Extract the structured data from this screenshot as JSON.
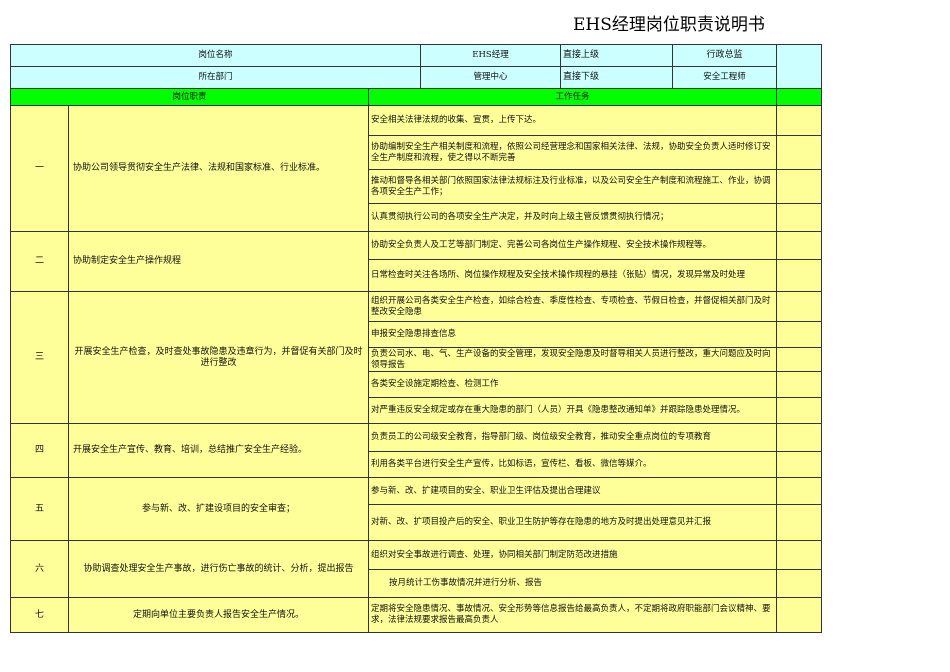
{
  "title": "EHS经理岗位职责说明书",
  "header": {
    "position_label": "岗位名称",
    "position_value": "EHS经理",
    "superior_label": "直接上级",
    "superior_value": "行政总监",
    "dept_label": "所在部门",
    "dept_value": "管理中心",
    "subordinate_label": "直接下级",
    "subordinate_value": "安全工程师"
  },
  "columns": {
    "duty": "岗位职责",
    "tasks": "工作任务"
  },
  "groups": [
    {
      "num": "一",
      "duty": "协助公司领导贯彻安全生产法律、法规和国家标准、行业标准。",
      "tasks": [
        "安全相关法律法规的收集、宣贯，上传下达。",
        "协助编制安全生产相关制度和流程，依照公司经营理念和国家相关法律、法规，协助安全负责人适时修订安全生产制度和流程，使之得以不断完善",
        "推动和督导各相关部门依照国家法律法规标注及行业标准，以及公司安全生产制度和流程施工、作业，协调各项安全生产工作；",
        "认真贯彻执行公司的各项安全生产决定，并及时向上级主管反馈贯彻执行情况；"
      ]
    },
    {
      "num": "二",
      "duty": "协助制定安全生产操作规程",
      "tasks": [
        "协助安全负责人及工艺等部门制定、完善公司各岗位生产操作规程、安全技术操作规程等。",
        "日常检查时关注各场所、岗位操作规程及安全技术操作规程的悬挂（张贴）情况，发现异常及时处理"
      ]
    },
    {
      "num": "三",
      "duty": "开展安全生产检查，及时查处事故隐患及违章行为，并督促有关部门及时进行整改",
      "tasks": [
        "组织开展公司各类安全生产检查，如综合检查、季度性检查、专项检查、节假日检查，并督促相关部门及时整改安全隐患",
        "申报安全隐患排查信息",
        "负责公司水、电、气、生产设备的安全管理，发现安全隐患及时督导相关人员进行整改，重大问题应及时向领导报告",
        "各类安全设施定期检查、检测工作",
        "对严重违反安全规定或存在重大隐患的部门（人员）开具《隐患整改通知单》并跟踪隐患处理情况。"
      ]
    },
    {
      "num": "四",
      "duty": "开展安全生产宣传、教育、培训，总结推广安全生产经验。",
      "tasks": [
        "负责员工的公司级安全教育，指导部门级、岗位级安全教育，推动安全重点岗位的专项教育",
        "利用各类平台进行安全生产宣传，比如标语，宣传栏、看板、微信等媒介。"
      ]
    },
    {
      "num": "五",
      "duty": "参与新、改、扩建设项目的安全审查；",
      "tasks": [
        "参与新、改、扩建项目的安全、职业卫生评估及提出合理建议",
        "对新、改、扩项目投产后的安全、职业卫生防护等存在隐患的地方及时提出处理意见并汇报"
      ]
    },
    {
      "num": "六",
      "duty": "协助调查处理安全生产事故，进行伤亡事故的统计、分析，提出报告",
      "tasks": [
        "组织对安全事故进行调查、处理，协同相关部门制定防范改进措施",
        "按月统计工伤事故情况并进行分析、报告"
      ]
    },
    {
      "num": "七",
      "duty": "定期向单位主要负责人报告安全生产情况。",
      "tasks": [
        "定期将安全隐患情况、事故情况、安全形势等信息报告给最高负责人，不定期将政府职能部门会议精神、要求，法律法规要求报告最高负责人"
      ]
    }
  ]
}
